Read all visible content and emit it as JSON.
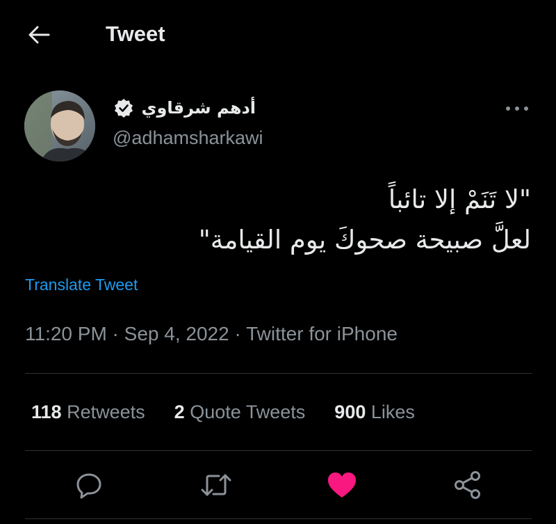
{
  "header": {
    "title": "Tweet"
  },
  "author": {
    "name": "أدهم شرقاوي",
    "handle": "@adhamsharkawi",
    "verified": true
  },
  "tweet": {
    "lines": [
      "\"لا تَنَمْ إلا تائباً",
      "لعلَّ صبيحة صحوكَ يوم القيامة\""
    ],
    "translate_label": "Translate Tweet",
    "time": "11:20 PM",
    "date": "Sep 4, 2022",
    "source": "Twitter for iPhone",
    "separator": " · "
  },
  "stats": {
    "retweets_count": "118",
    "retweets_label": "Retweets",
    "quotes_count": "2",
    "quotes_label": "Quote Tweets",
    "likes_count": "900",
    "likes_label": "Likes"
  },
  "colors": {
    "background": "#000000",
    "text": "#e7e9ea",
    "secondary": "#8b9298",
    "link": "#1d9bf0",
    "like": "#f91880",
    "divider": "#2f3336"
  },
  "icons": {
    "back": "arrow-left-icon",
    "verified": "verified-badge-icon",
    "more": "more-dots-icon",
    "reply": "reply-icon",
    "retweet": "retweet-icon",
    "like": "heart-icon",
    "share": "share-icon"
  }
}
